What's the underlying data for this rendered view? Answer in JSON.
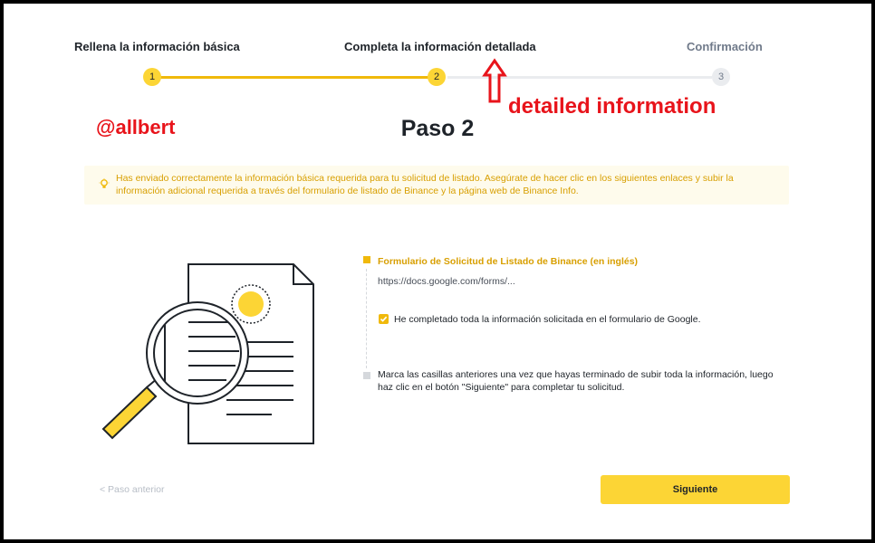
{
  "steps": [
    {
      "label": "Rellena la información básica",
      "number": "1",
      "state": "done"
    },
    {
      "label": "Completa la información detallada",
      "number": "2",
      "state": "current"
    },
    {
      "label": "Confirmación",
      "number": "3",
      "state": "todo"
    }
  ],
  "annotation": {
    "caption": "detailed information",
    "watermark": "@allbert",
    "color": "#e8141b"
  },
  "page": {
    "title": "Paso 2"
  },
  "alert": {
    "icon": "lightbulb-icon",
    "text": "Has enviado correctamente la información básica requerida para tu solicitud de listado. Asegúrate de hacer clic en los siguientes enlaces y subir la información adicional requerida a través del formulario de listado de Binance y la página web de Binance Info."
  },
  "form": {
    "title": "Formulario de Solicitud de Listado de Binance (en inglés)",
    "url": "https://docs.google.com/forms/...",
    "checkbox_label": "He completado toda la información solicitada en el formulario de Google.",
    "checked": true,
    "hint": "Marca las casillas anteriores una vez que hayas terminado de subir toda la información, luego haz clic en el botón \"Siguiente\" para completar tu solicitud."
  },
  "footer": {
    "back_label": "< Paso anterior",
    "next_label": "Siguiente"
  },
  "colors": {
    "accent": "#fcd535",
    "accent_dark": "#f0b90b",
    "alert_bg": "#fefbec",
    "alert_text": "#d89f00"
  }
}
